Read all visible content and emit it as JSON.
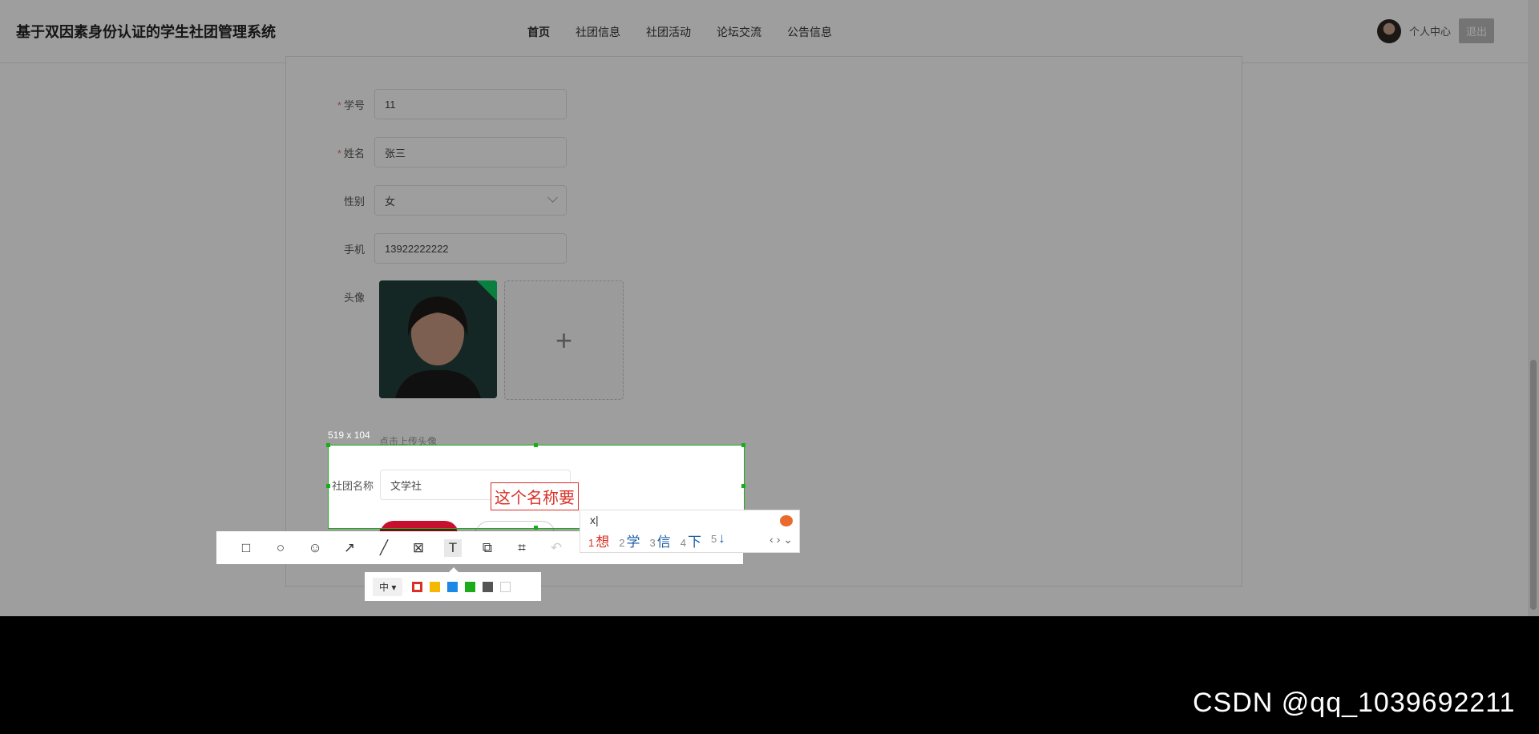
{
  "header": {
    "title": "基于双因素身份认证的学生社团管理系统",
    "nav": [
      "首页",
      "社团信息",
      "社团活动",
      "论坛交流",
      "公告信息"
    ],
    "user_center": "个人中心",
    "logout": "退出"
  },
  "form": {
    "fields": [
      {
        "label": "学号",
        "value": "11",
        "required": true
      },
      {
        "label": "姓名",
        "value": "张三",
        "required": true
      },
      {
        "label": "性别",
        "value": "女",
        "required": false
      },
      {
        "label": "手机",
        "value": "13922222222",
        "required": false
      }
    ],
    "avatar_label": "头像",
    "avatar_hint": "点击上传头像",
    "club_name_label": "社团名称",
    "club_name_value": "文学社"
  },
  "screenshot_tool": {
    "size": "519 x 104",
    "annotation_text": "这个名称要",
    "tools": [
      "rectangle-icon",
      "circle-icon",
      "emoji-icon",
      "arrow-icon",
      "line-icon",
      "mosaic-icon",
      "text-icon",
      "copy-icon",
      "ocr-icon",
      "undo-icon"
    ],
    "font_size": "中",
    "colors": [
      "#d93025",
      "#f5b800",
      "#1e88e5",
      "#1aad19",
      "#555555",
      "#ffffff"
    ]
  },
  "ime": {
    "input": "x",
    "candidates": [
      {
        "num": "1",
        "text": "想"
      },
      {
        "num": "2",
        "text": "学"
      },
      {
        "num": "3",
        "text": "信"
      },
      {
        "num": "4",
        "text": "下"
      },
      {
        "num": "5",
        "text": "↓"
      }
    ]
  },
  "watermark": "CSDN @qq_1039692211"
}
